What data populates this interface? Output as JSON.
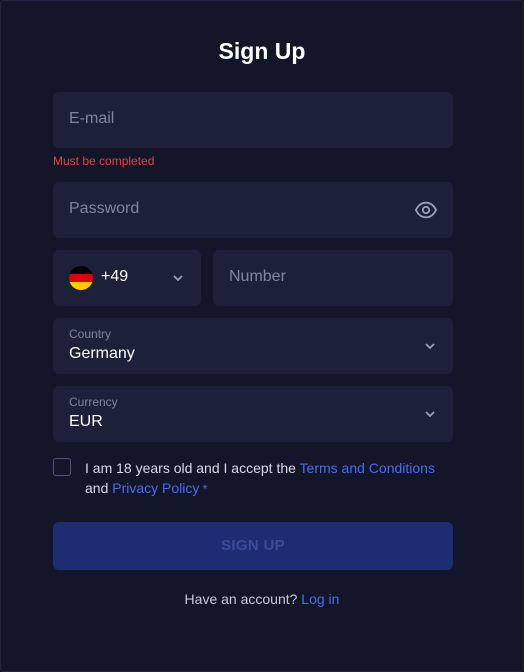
{
  "form": {
    "title": "Sign Up",
    "email": {
      "placeholder": "E-mail",
      "error": "Must be completed"
    },
    "password": {
      "placeholder": "Password",
      "toggle_icon": "eye-icon"
    },
    "phone": {
      "flag_icon": "germany-flag-icon",
      "code": "+49",
      "number_placeholder": "Number"
    },
    "country": {
      "label": "Country",
      "value": "Germany"
    },
    "currency": {
      "label": "Currency",
      "value": "EUR"
    },
    "terms": {
      "prefix": "I am 18 years old and I accept the ",
      "terms_link": "Terms and Conditions",
      "and": "and ",
      "privacy_link": "Privacy Policy",
      "required_mark": " *",
      "checked": false
    },
    "submit_label": "SIGN UP",
    "login_prompt": "Have an account?",
    "login_link": "Log in"
  },
  "colors": {
    "background": "#121628",
    "field": "#1c2038",
    "error": "#e8413f",
    "link": "#4a6cf0",
    "submit_bg": "#1e2c73",
    "submit_text": "#3b4d9a"
  }
}
